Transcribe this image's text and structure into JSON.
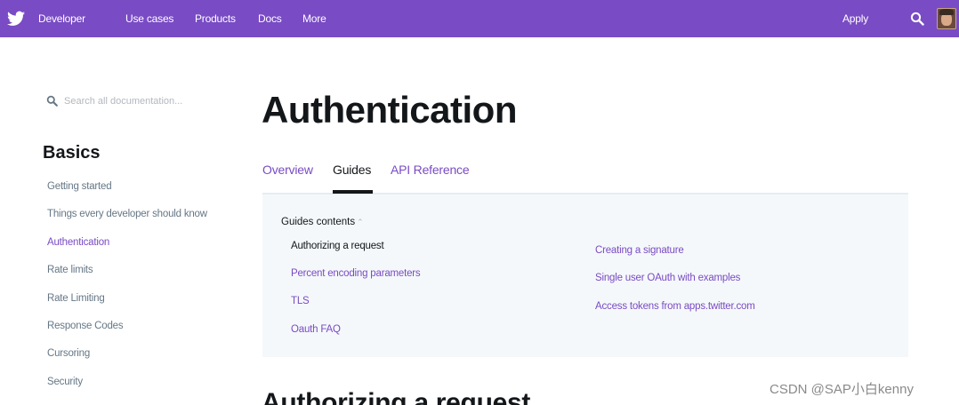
{
  "topbar": {
    "brand": "Developer",
    "nav": [
      "Use cases",
      "Products",
      "Docs",
      "More"
    ],
    "apply": "Apply",
    "colors": {
      "background": "#794bc4",
      "text": "#ffffff"
    }
  },
  "sidebar": {
    "search_placeholder": "Search all documentation...",
    "heading": "Basics",
    "items": [
      {
        "label": "Getting started",
        "active": false
      },
      {
        "label": "Things every developer should know",
        "active": false
      },
      {
        "label": "Authentication",
        "active": true
      },
      {
        "label": "Rate limits",
        "active": false
      },
      {
        "label": "Rate Limiting",
        "active": false
      },
      {
        "label": "Response Codes",
        "active": false
      },
      {
        "label": "Cursoring",
        "active": false
      },
      {
        "label": "Security",
        "active": false
      }
    ]
  },
  "main": {
    "title": "Authentication",
    "tabs": [
      {
        "label": "Overview",
        "active": false
      },
      {
        "label": "Guides",
        "active": true
      },
      {
        "label": "API Reference",
        "active": false
      }
    ],
    "guides": {
      "header": "Guides contents",
      "header_icon": "chevron-up-icon",
      "left": [
        "Authorizing a request",
        "Percent encoding parameters",
        "TLS",
        "Oauth FAQ"
      ],
      "right": [
        "Creating a signature",
        "Single user OAuth with examples",
        "Access tokens from apps.twitter.com"
      ]
    },
    "section_heading": "Authorizing a request"
  },
  "watermark": "CSDN @SAP小白kenny",
  "colors": {
    "accent": "#794bc4",
    "text": "#14171a",
    "muted": "#657786",
    "panel": "#f5f8fa"
  }
}
